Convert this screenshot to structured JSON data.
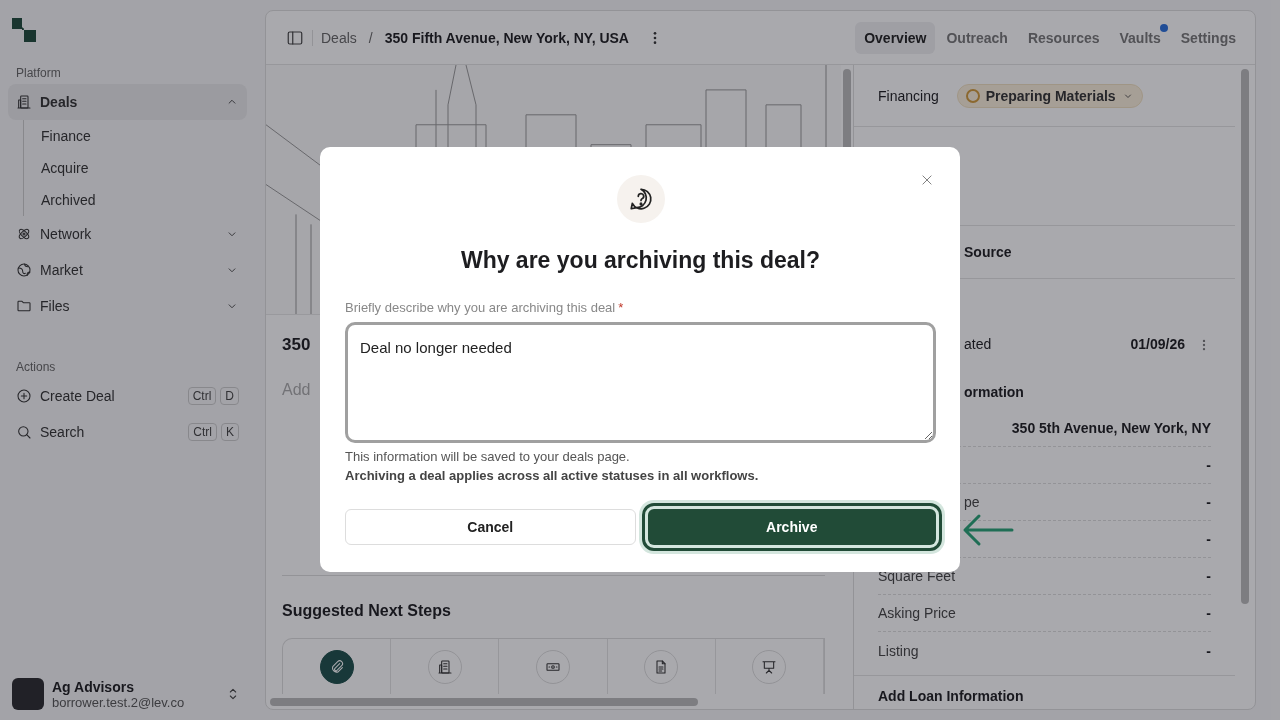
{
  "sidebar": {
    "sections": [
      {
        "title": "Platform",
        "items": [
          {
            "label": "Deals",
            "selected": true,
            "expanded": true,
            "children": [
              {
                "label": "Finance",
                "selected": false
              },
              {
                "label": "Acquire",
                "selected": false
              },
              {
                "label": "Archived",
                "selected": false
              }
            ]
          },
          {
            "label": "Network",
            "selected": false,
            "expanded": false
          },
          {
            "label": "Market",
            "selected": false,
            "expanded": false
          },
          {
            "label": "Files",
            "selected": false,
            "expanded": false
          }
        ]
      },
      {
        "title": "Actions",
        "items": [
          {
            "label": "Create Deal",
            "shortcut": [
              "Ctrl",
              "D"
            ]
          },
          {
            "label": "Search",
            "shortcut": [
              "Ctrl",
              "K"
            ]
          }
        ]
      }
    ],
    "user": {
      "name": "Ag Advisors",
      "email": "borrower.test.2@lev.co"
    }
  },
  "topbar": {
    "breadcrumb": [
      "Deals",
      "350 Fifth Avenue, New York, NY, USA"
    ],
    "separator": "/",
    "tabs": [
      {
        "label": "Overview",
        "selected": true,
        "dot": false
      },
      {
        "label": "Outreach",
        "selected": false,
        "dot": false
      },
      {
        "label": "Resources",
        "selected": false,
        "dot": false
      },
      {
        "label": "Vaults",
        "selected": false,
        "dot": true
      },
      {
        "label": "Settings",
        "selected": false,
        "dot": false
      }
    ]
  },
  "main": {
    "title_fragment": "350",
    "description_fragment": "Add",
    "suggested_title": "Suggested Next Steps",
    "steps": [
      {
        "selected": true
      },
      {
        "selected": false
      },
      {
        "selected": false
      },
      {
        "selected": false
      },
      {
        "selected": false
      }
    ]
  },
  "details": {
    "financing_label": "Financing",
    "status": "Preparing Materials",
    "source_fragment": "Source",
    "created_fragment": "ated",
    "created_value": "01/09/26",
    "property_heading_fragment": "ormation",
    "property_rows": [
      {
        "value": "350 5th Avenue, New York, NY"
      },
      {
        "value": "-"
      },
      {
        "label_fragment": "pe",
        "value": "-"
      },
      {
        "value": "-"
      },
      {
        "label": "Square Feet",
        "value": "-"
      },
      {
        "label": "Asking Price",
        "value": "-"
      },
      {
        "label": "Listing",
        "value": "-"
      }
    ],
    "loan_heading": "Add Loan Information"
  },
  "dialog": {
    "title": "Why are you archiving this deal?",
    "field_label": "Briefly describe why you are archiving this deal",
    "required": true,
    "required_mark": "*",
    "value": "Deal no longer needed",
    "help": "This information will be saved to your deals page.",
    "note": "Archiving a deal applies across all active statuses in all workflows.",
    "buttons": [
      {
        "label": "Cancel",
        "kind": "secondary",
        "focused": false
      },
      {
        "label": "Archive",
        "kind": "primary",
        "focused": true
      }
    ]
  }
}
